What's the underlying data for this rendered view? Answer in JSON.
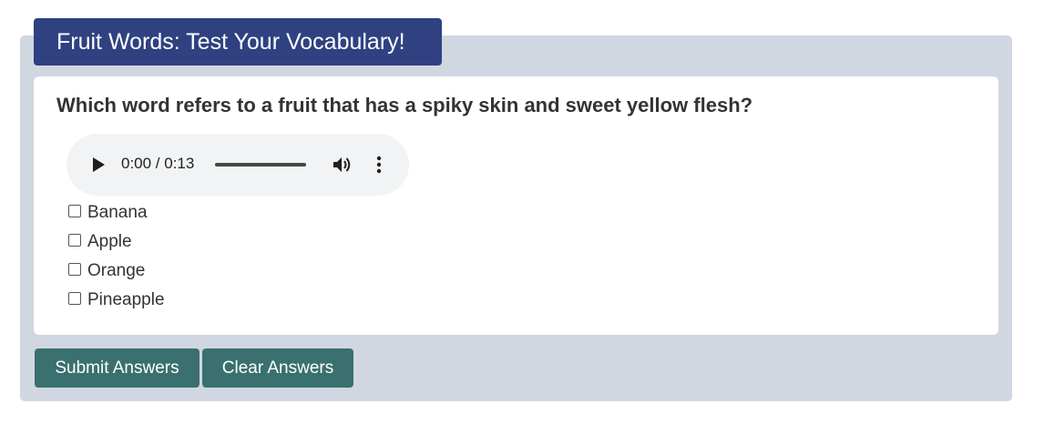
{
  "header": {
    "title": "Fruit Words: Test Your Vocabulary!"
  },
  "quiz": {
    "question": "Which word refers to a fruit that has a spiky skin and sweet yellow flesh?",
    "audio": {
      "time": "0:00 / 0:13",
      "progress": 0,
      "icons": [
        "play-icon",
        "volume-icon",
        "more-vertical-icon"
      ]
    },
    "options": [
      {
        "label": "Banana",
        "checked": false
      },
      {
        "label": "Apple",
        "checked": false
      },
      {
        "label": "Orange",
        "checked": false
      },
      {
        "label": "Pineapple",
        "checked": false
      }
    ]
  },
  "actions": {
    "submit_label": "Submit Answers",
    "clear_label": "Clear Answers"
  },
  "colors": {
    "header_bg": "#2f4180",
    "panel_bg": "#d1d7e1",
    "button_bg": "#3a706f"
  }
}
